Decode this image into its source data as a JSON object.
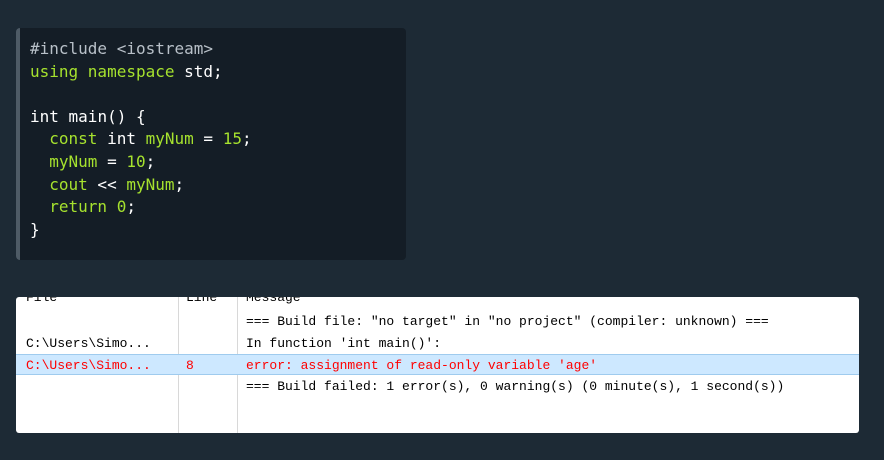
{
  "code": {
    "lines": [
      [
        {
          "t": "pre",
          "v": "#include <iostream>"
        }
      ],
      [
        {
          "t": "kw",
          "v": "using namespace"
        },
        {
          "t": "plain",
          "v": " std;"
        }
      ],
      [
        {
          "t": "plain",
          "v": " "
        }
      ],
      [
        {
          "t": "type",
          "v": "int"
        },
        {
          "t": "plain",
          "v": " main() {"
        }
      ],
      [
        {
          "t": "plain",
          "v": "  "
        },
        {
          "t": "kw",
          "v": "const"
        },
        {
          "t": "plain",
          "v": " int "
        },
        {
          "t": "id",
          "v": "myNum"
        },
        {
          "t": "plain",
          "v": " = "
        },
        {
          "t": "num",
          "v": "15"
        },
        {
          "t": "plain",
          "v": ";"
        }
      ],
      [
        {
          "t": "plain",
          "v": "  "
        },
        {
          "t": "id",
          "v": "myNum"
        },
        {
          "t": "plain",
          "v": " = "
        },
        {
          "t": "num",
          "v": "10"
        },
        {
          "t": "plain",
          "v": ";"
        }
      ],
      [
        {
          "t": "plain",
          "v": "  "
        },
        {
          "t": "kw",
          "v": "cout"
        },
        {
          "t": "plain",
          "v": " << "
        },
        {
          "t": "id",
          "v": "myNum"
        },
        {
          "t": "plain",
          "v": ";"
        }
      ],
      [
        {
          "t": "plain",
          "v": "  "
        },
        {
          "t": "kw",
          "v": "return"
        },
        {
          "t": "plain",
          "v": " "
        },
        {
          "t": "num",
          "v": "0"
        },
        {
          "t": "plain",
          "v": ";"
        }
      ],
      [
        {
          "t": "plain",
          "v": "}"
        }
      ]
    ]
  },
  "build_log": {
    "columns": {
      "file": "File",
      "line": "Line",
      "message": "Message"
    },
    "rows": [
      {
        "file": "",
        "line": "",
        "message": "=== Build file: \"no target\" in \"no project\" (compiler: unknown) ===",
        "error": false
      },
      {
        "file": "C:\\Users\\Simo...",
        "line": "",
        "message": "In function 'int main()':",
        "error": false
      },
      {
        "file": "C:\\Users\\Simo...",
        "line": "8",
        "message": "error: assignment of read-only variable 'age'",
        "error": true
      },
      {
        "file": "",
        "line": "",
        "message": "=== Build failed: 1 error(s), 0 warning(s) (0 minute(s), 1 second(s))",
        "error": false
      }
    ]
  }
}
